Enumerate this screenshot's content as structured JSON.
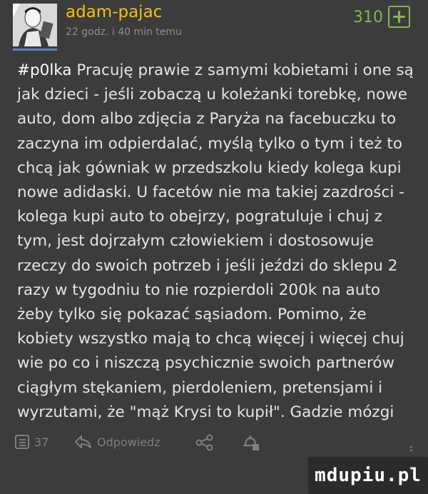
{
  "post": {
    "username": "adam-pajac",
    "timestamp": "22 godz. i 40 min temu",
    "score": "310",
    "tag": "#p0lka",
    "body": "Pracuję prawie z samymi kobietami i one są jak dzieci - jeśli zobaczą u koleżanki torebkę, nowe auto, dom albo zdjęcia z Paryża na facebuczku to zaczyna im odpierdalać, myślą tylko o tym i też to chcą jak gówniak w przedszkolu kiedy kolega kupi nowe adidaski. U facetów nie ma takiej zazdrości - kolega kupi auto to obejrzy, pogratuluje i chuj z tym, jest dojrzałym człowiekiem i dostosowuje rzeczy do swoich potrzeb i jeśli jeździ do sklepu 2 razy w tygodniu to nie rozpierdoli 200k na auto żeby tylko się pokazać sąsiadom. Pomimo, że kobiety wszystko mają to chcą więcej i więcej chuj wie po co i niszczą psychicznie swoich partnerów ciągłym stękaniem, pierdoleniem, pretensjami i wyrzutami, że \"mąż Krysi to kupił\". Gadzie mózgi"
  },
  "actions": {
    "comments_count": "37",
    "reply_label": "Odpowiedz"
  },
  "watermark": "mdupiu.pl",
  "colors": {
    "username": "#f2c10f",
    "score": "#86b64f",
    "background": "#3c3c3c"
  },
  "icons": [
    "plus-icon",
    "comment-icon",
    "reply-icon",
    "share-icon",
    "bookmark-icon"
  ]
}
